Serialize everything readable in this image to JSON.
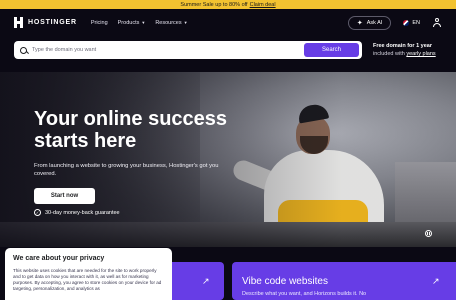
{
  "promo": {
    "text": "Summer Sale up to 80% off",
    "link": "Claim deal"
  },
  "nav": {
    "logo": "HOSTINGER",
    "links": [
      {
        "label": "Pricing",
        "has_dropdown": false
      },
      {
        "label": "Products",
        "has_dropdown": true
      },
      {
        "label": "Resources",
        "has_dropdown": true
      }
    ],
    "ask_ai": "Ask AI",
    "language": "EN",
    "icons": {
      "ask_ai": "sparkle-icon",
      "user": "user-icon",
      "chevron": "chevron-down-icon"
    }
  },
  "search": {
    "placeholder": "Type the domain you want",
    "button": "Search",
    "promo_title": "Free domain for 1 year",
    "promo_prefix": "included with",
    "promo_link": "yearly plans"
  },
  "hero": {
    "title": "Your online success starts here",
    "subtitle": "From launching a website to growing your business, Hostinger's got you covered.",
    "cta": "Start now",
    "guarantee": "30-day money-back guarantee",
    "guarantee_icon": "shield-check-icon",
    "pause_icon": "pause-icon"
  },
  "cards": [
    {
      "title": "",
      "description": "",
      "icon": "arrow-up-right-icon"
    },
    {
      "title": "Vibe code websites",
      "description": "Describe what you want, and Horizons builds it. No",
      "icon": "arrow-up-right-icon"
    }
  ],
  "cookie": {
    "title": "We care about your privacy",
    "text": "This website uses cookies that are needed for the site to work properly and to get data on how you interact with it, as well as for marketing purposes. By accepting, you agree to store cookies on your device for ad targeting, personalization, and analytics as"
  },
  "colors": {
    "accent": "#673de6",
    "promo_bar": "#f2c230",
    "background": "#0b0914"
  }
}
